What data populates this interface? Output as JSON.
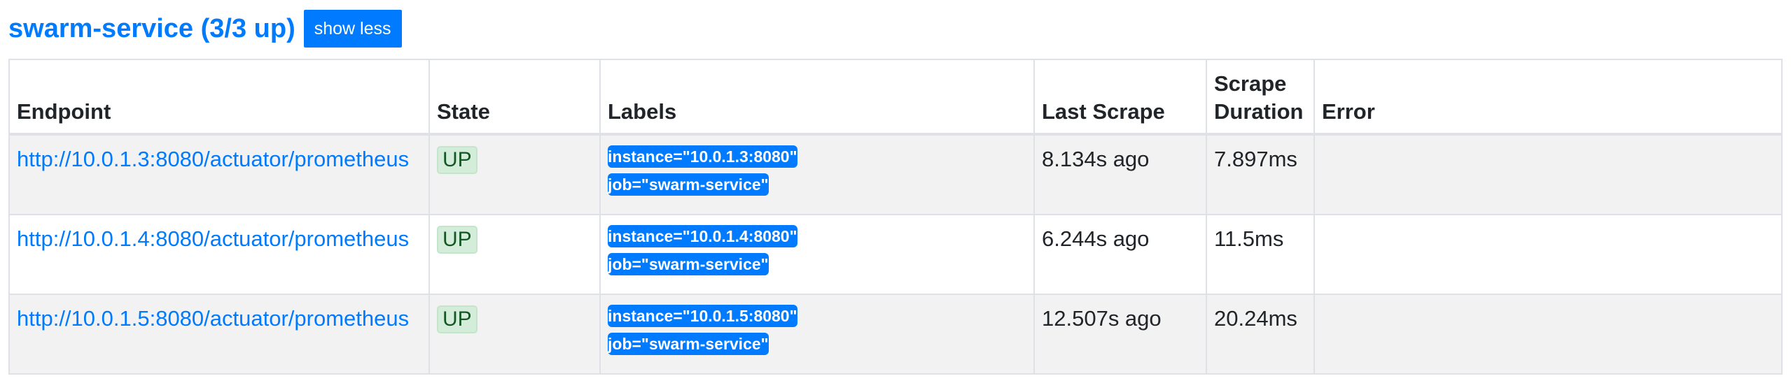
{
  "header": {
    "title": "swarm-service (3/3 up)",
    "toggle_label": "show less"
  },
  "table": {
    "columns": [
      "Endpoint",
      "State",
      "Labels",
      "Last Scrape",
      "Scrape Duration",
      "Error"
    ],
    "rows": [
      {
        "endpoint": "http://10.0.1.3:8080/actuator/prometheus",
        "state": "UP",
        "labels": [
          "instance=\"10.0.1.3:8080\"",
          "job=\"swarm-service\""
        ],
        "last_scrape": "8.134s ago",
        "scrape_duration": "7.897ms",
        "error": ""
      },
      {
        "endpoint": "http://10.0.1.4:8080/actuator/prometheus",
        "state": "UP",
        "labels": [
          "instance=\"10.0.1.4:8080\"",
          "job=\"swarm-service\""
        ],
        "last_scrape": "6.244s ago",
        "scrape_duration": "11.5ms",
        "error": ""
      },
      {
        "endpoint": "http://10.0.1.5:8080/actuator/prometheus",
        "state": "UP",
        "labels": [
          "instance=\"10.0.1.5:8080\"",
          "job=\"swarm-service\""
        ],
        "last_scrape": "12.507s ago",
        "scrape_duration": "20.24ms",
        "error": ""
      }
    ]
  },
  "colors": {
    "accent": "#007bff",
    "state_up_bg": "#d4edda",
    "state_up_text": "#155724",
    "row_stripe": "#f2f2f2",
    "border": "#dee2e6"
  }
}
